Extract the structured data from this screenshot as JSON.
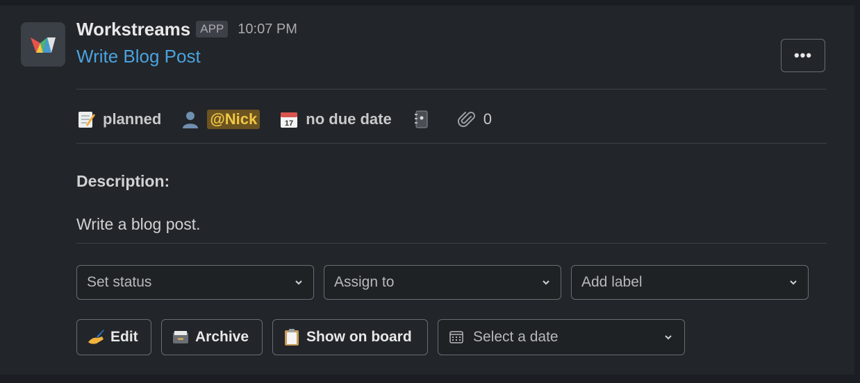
{
  "app": {
    "name": "Workstreams",
    "badge": "APP",
    "timestamp": "10:07 PM",
    "avatar_icon": "workstreams-logo"
  },
  "task": {
    "title": "Write Blog Post",
    "more_label": "•••",
    "meta": {
      "status_icon": "memo-icon",
      "status": "planned",
      "assignee_icon": "person-icon",
      "assignee": "@Nick",
      "due_icon": "calendar-icon",
      "due": "no due date",
      "notebook_icon": "notebook-icon",
      "attachments_icon": "paperclip-icon",
      "attachments": "0"
    },
    "description_label": "Description:",
    "description": "Write a blog post."
  },
  "actions": {
    "selects": [
      {
        "placeholder": "Set status"
      },
      {
        "placeholder": "Assign to"
      },
      {
        "placeholder": "Add label"
      }
    ],
    "buttons": [
      {
        "label": "Edit",
        "icon": "writing-hand-icon"
      },
      {
        "label": "Archive",
        "icon": "card-file-box-icon"
      },
      {
        "label": "Show on board",
        "icon": "clipboard-icon"
      }
    ],
    "date_picker": {
      "placeholder": "Select a date",
      "icon": "calendar-grid-icon"
    }
  },
  "colors": {
    "background": "#1a1d21",
    "panel": "#222529",
    "link": "#4aa3df",
    "mention_bg": "#6b5421",
    "mention_text": "#f2c744"
  }
}
